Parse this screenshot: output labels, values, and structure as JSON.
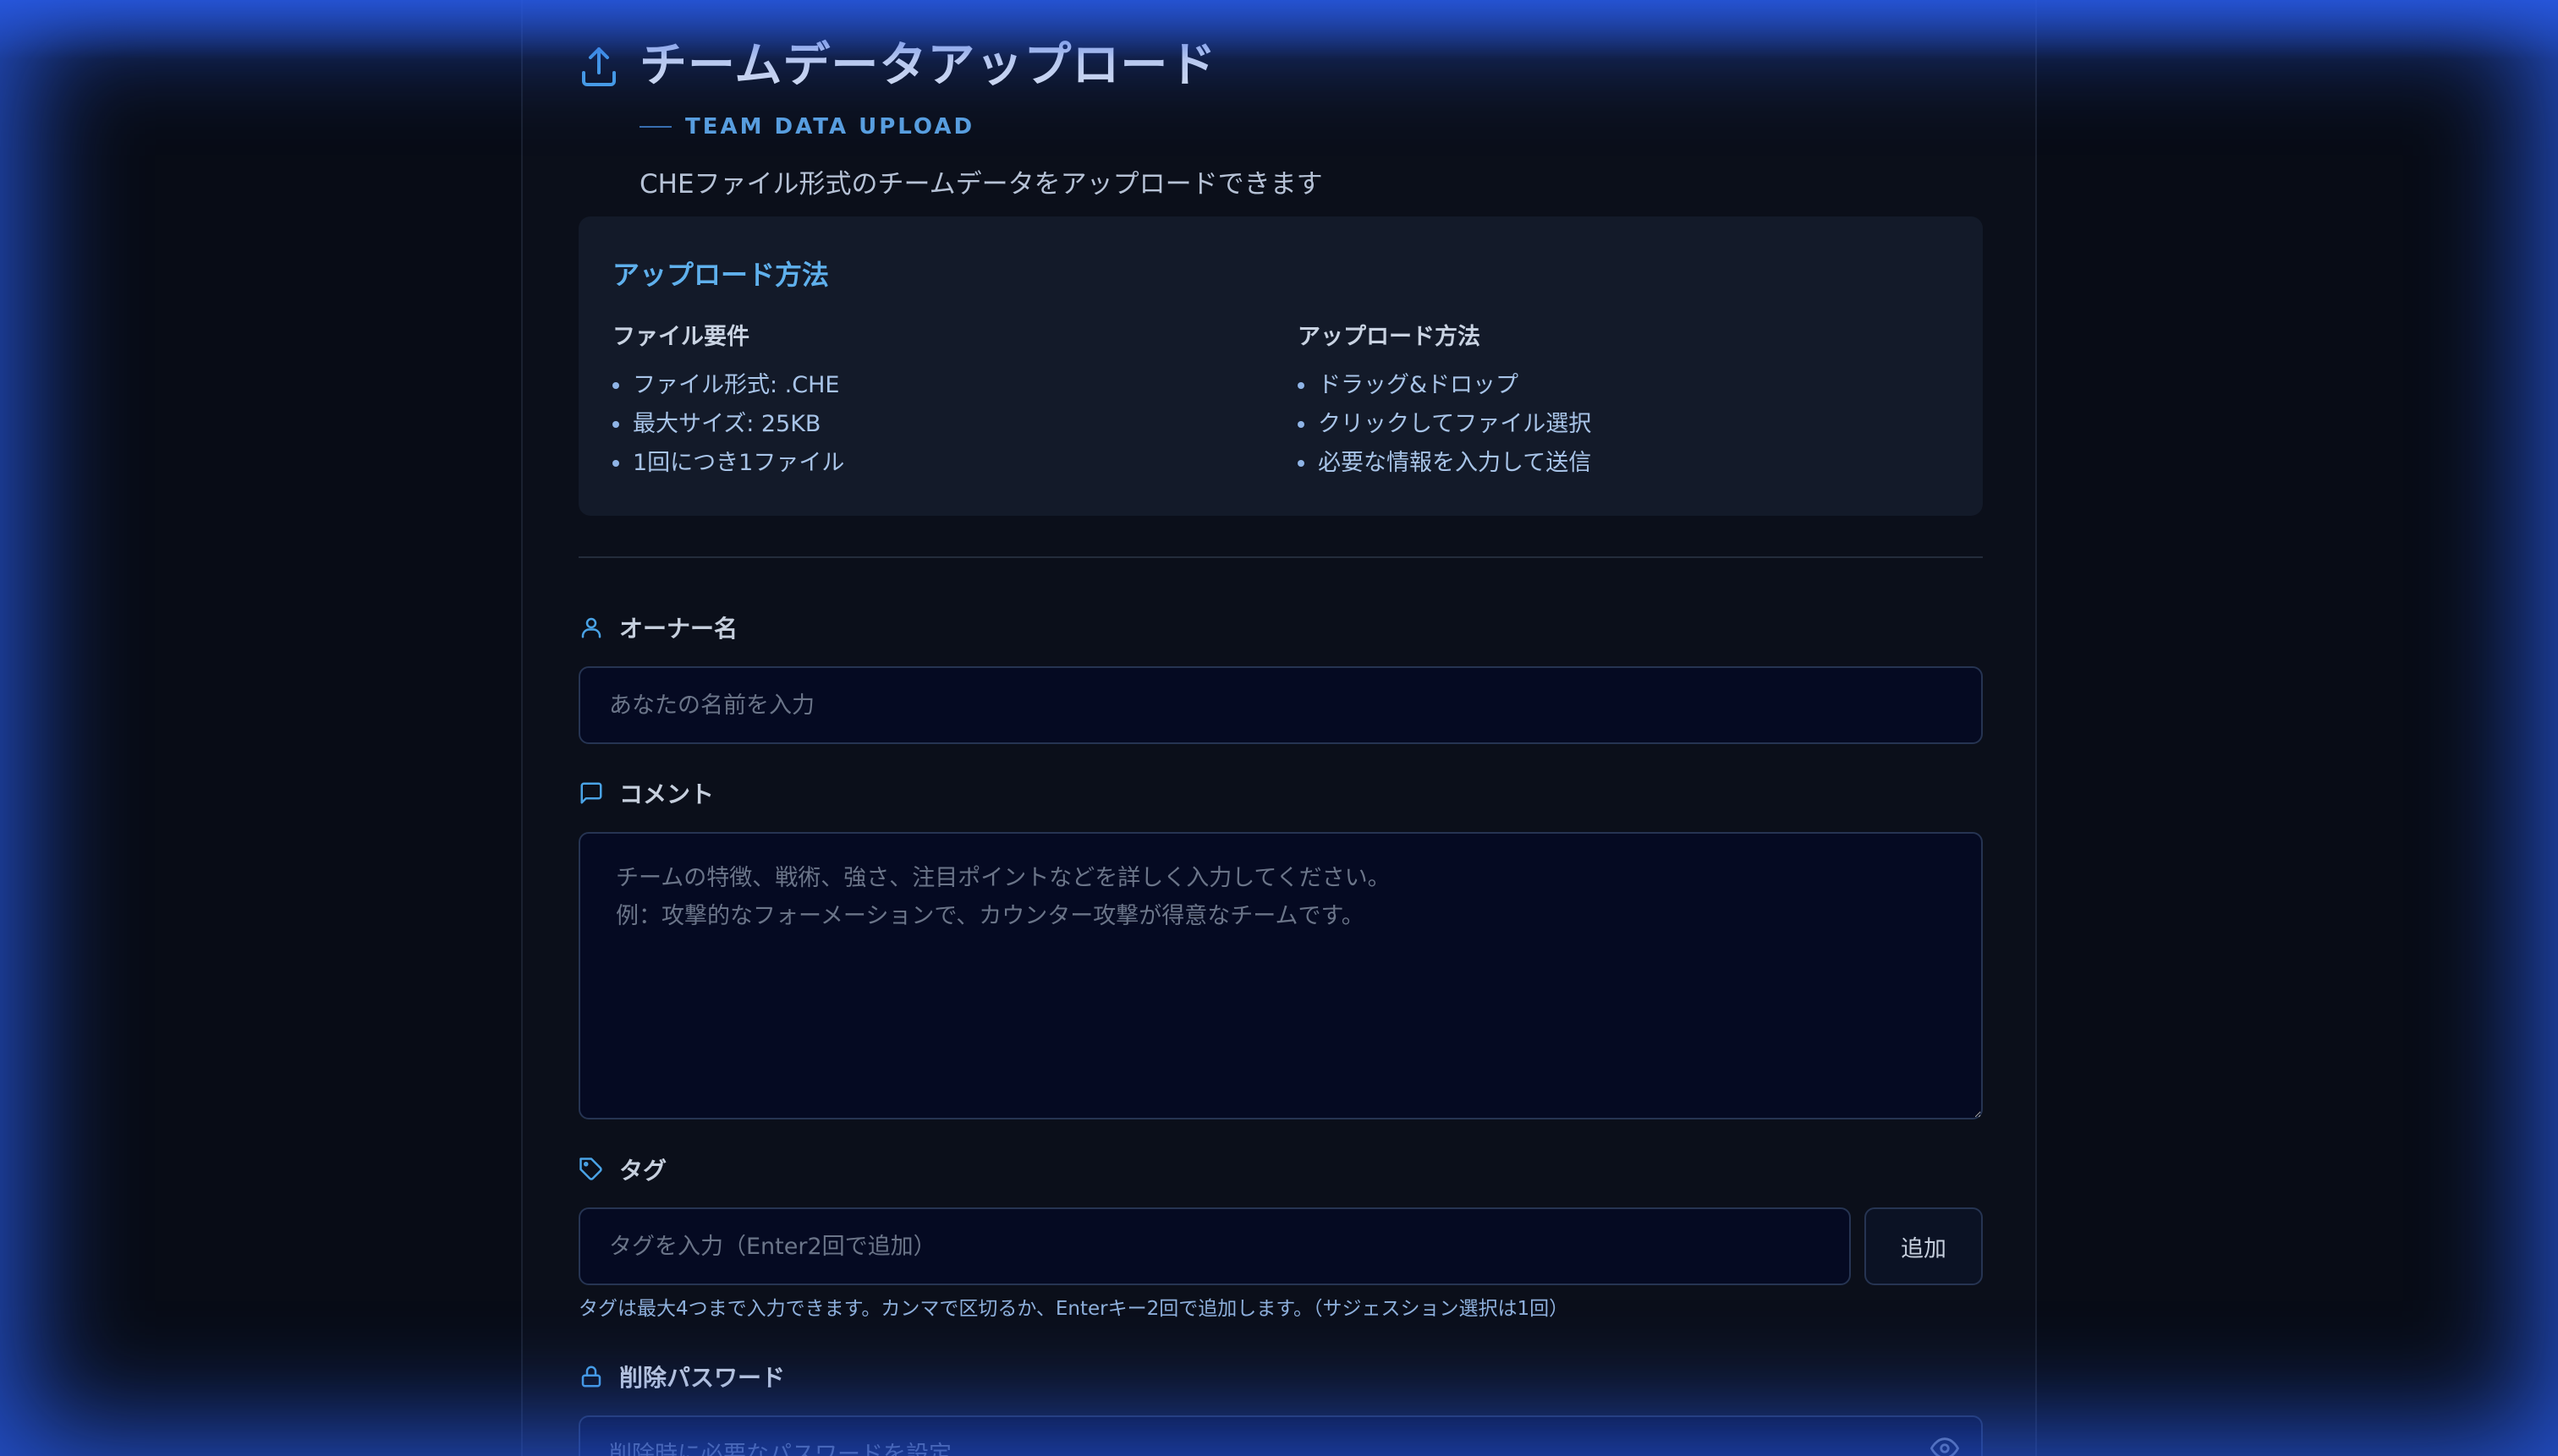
{
  "header": {
    "title": "チームデータアップロード",
    "subtitle": "TEAM DATA UPLOAD",
    "description": "CHEファイル形式のチームデータをアップロードできます"
  },
  "info": {
    "title": "アップロード方法",
    "requirements": {
      "heading": "ファイル要件",
      "items": [
        "ファイル形式: .CHE",
        "最大サイズ: 25KB",
        "1回につき1ファイル"
      ]
    },
    "methods": {
      "heading": "アップロード方法",
      "items": [
        "ドラッグ&ドロップ",
        "クリックしてファイル選択",
        "必要な情報を入力して送信"
      ]
    }
  },
  "form": {
    "owner": {
      "label": "オーナー名",
      "placeholder": "あなたの名前を入力",
      "value": ""
    },
    "comment": {
      "label": "コメント",
      "placeholder": "チームの特徴、戦術、強さ、注目ポイントなどを詳しく入力してください。\n例：攻撃的なフォーメーションで、カウンター攻撃が得意なチームです。",
      "value": ""
    },
    "tags": {
      "label": "タグ",
      "placeholder": "タグを入力（Enter2回で追加）",
      "value": "",
      "add_label": "追加",
      "hint": "タグは最大4つまで入力できます。カンマで区切るか、Enterキー2回で追加します。（サジェスション選択は1回）"
    },
    "password": {
      "label": "削除パスワード",
      "placeholder": "削除時に必要なパスワードを設定",
      "value": ""
    }
  },
  "colors": {
    "accent": "#5fb0ec",
    "input_bg": "#050a22",
    "glow": "#285ae6"
  },
  "icons": {
    "header": "upload-icon",
    "owner": "user-icon",
    "comment": "message-square-icon",
    "tags": "tag-icon",
    "password": "lock-icon",
    "password_toggle": "eye-icon"
  }
}
